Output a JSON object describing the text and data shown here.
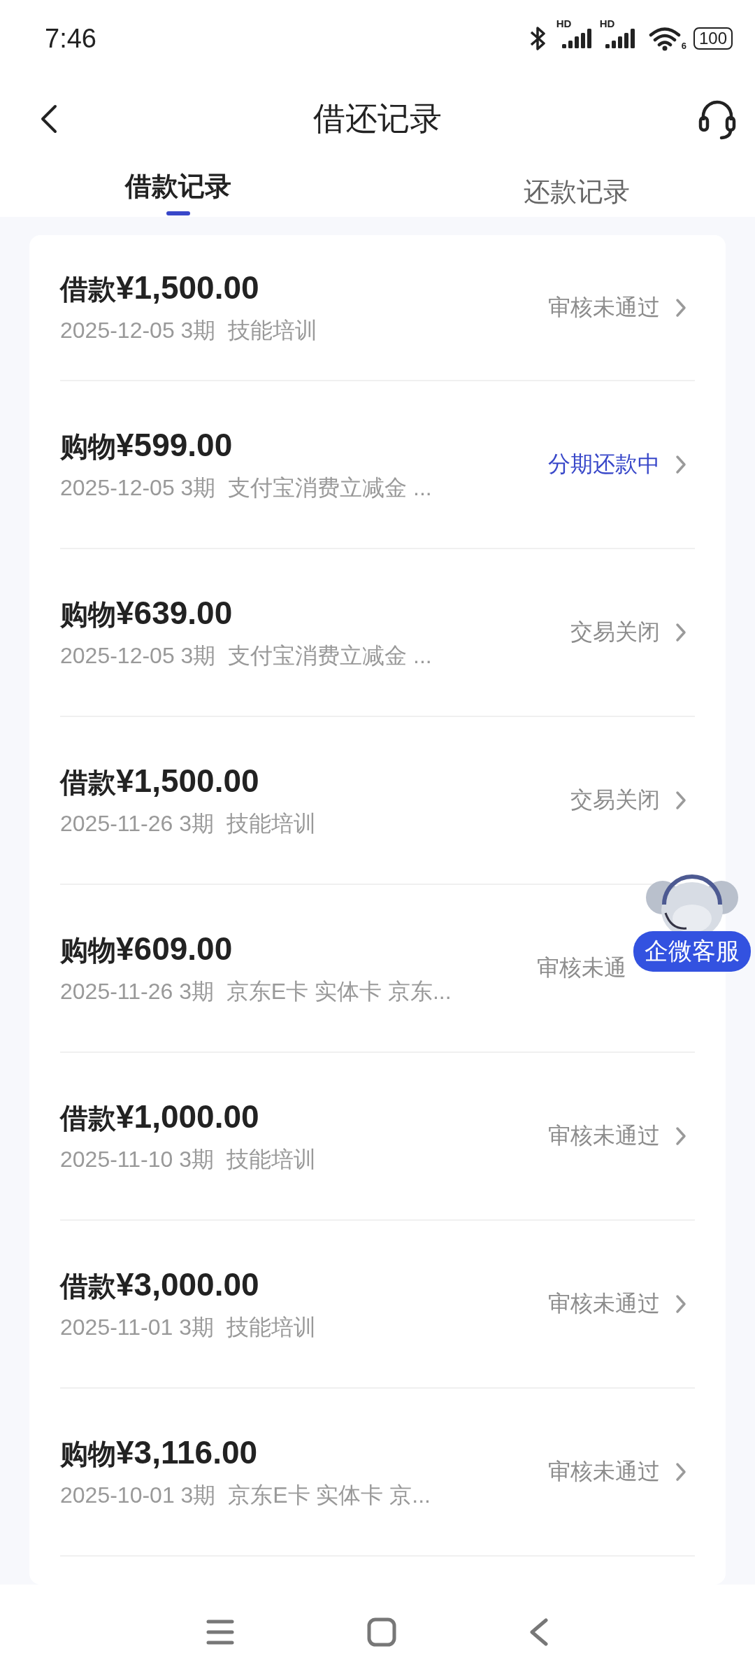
{
  "status_bar": {
    "time": "7:46",
    "signals": [
      {
        "label": "HD"
      },
      {
        "label": "HD"
      }
    ],
    "wifi_label": "6",
    "battery": "100"
  },
  "header": {
    "title": "借还记录"
  },
  "tabs": [
    {
      "label": "借款记录",
      "selected": true
    },
    {
      "label": "还款记录",
      "selected": false
    }
  ],
  "records": [
    {
      "type": "借款",
      "amount": "¥1,500.00",
      "meta": "2025-12-05 3期",
      "detail": "技能培训",
      "status": "审核未通过",
      "status_active": false,
      "chevron": true
    },
    {
      "type": "购物",
      "amount": "¥599.00",
      "meta": "2025-12-05 3期",
      "detail": "支付宝消费立减金 ...",
      "status": "分期还款中",
      "status_active": true,
      "chevron": true
    },
    {
      "type": "购物",
      "amount": "¥639.00",
      "meta": "2025-12-05 3期",
      "detail": "支付宝消费立减金 ...",
      "status": "交易关闭",
      "status_active": false,
      "chevron": true
    },
    {
      "type": "借款",
      "amount": "¥1,500.00",
      "meta": "2025-11-26 3期",
      "detail": "技能培训",
      "status": "交易关闭",
      "status_active": false,
      "chevron": true
    },
    {
      "type": "购物",
      "amount": "¥609.00",
      "meta": "2025-11-26 3期",
      "detail": "京东E卡 实体卡 京东...",
      "status": "审核未通",
      "status_active": false,
      "chevron": false
    },
    {
      "type": "借款",
      "amount": "¥1,000.00",
      "meta": "2025-11-10 3期",
      "detail": "技能培训",
      "status": "审核未通过",
      "status_active": false,
      "chevron": true
    },
    {
      "type": "借款",
      "amount": "¥3,000.00",
      "meta": "2025-11-01 3期",
      "detail": "技能培训",
      "status": "审核未通过",
      "status_active": false,
      "chevron": true
    },
    {
      "type": "购物",
      "amount": "¥3,116.00",
      "meta": "2025-10-01 3期",
      "detail": "京东E卡 实体卡 京...",
      "status": "审核未通过",
      "status_active": false,
      "chevron": true
    }
  ],
  "floating_service": {
    "label": "企微客服"
  }
}
